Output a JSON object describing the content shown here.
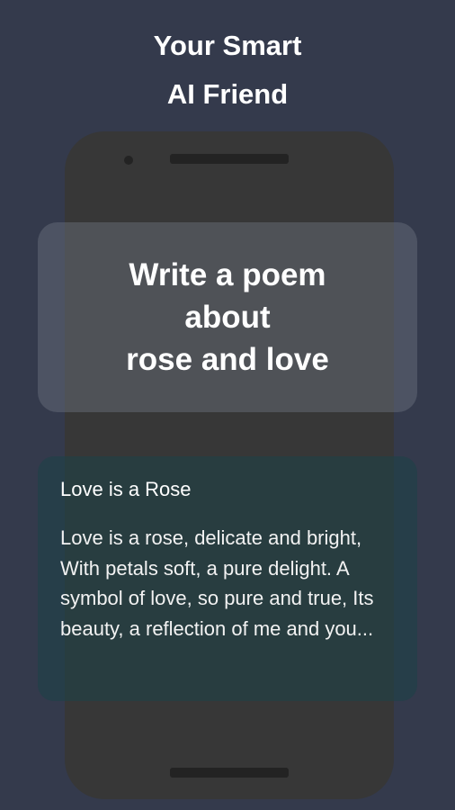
{
  "headline": {
    "line1": "Your Smart",
    "line2": "AI Friend"
  },
  "prompt": {
    "line1": "Write a poem",
    "line2": "about",
    "line3": "rose and love"
  },
  "answer": {
    "title": "Love is a Rose",
    "body": "Love is a rose, delicate and bright, With petals soft, a pure delight. A symbol of love, so pure and true, Its beauty, a reflection of me and you..."
  },
  "colors": {
    "background": "#343a4c",
    "phone": "#373737",
    "text": "#ffffff"
  }
}
